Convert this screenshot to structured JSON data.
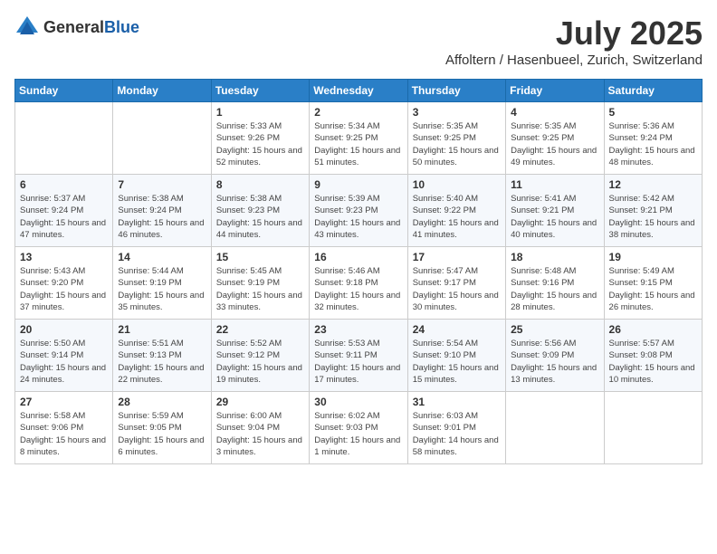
{
  "logo": {
    "general": "General",
    "blue": "Blue"
  },
  "header": {
    "month_title": "July 2025",
    "location": "Affoltern / Hasenbueel, Zurich, Switzerland"
  },
  "weekdays": [
    "Sunday",
    "Monday",
    "Tuesday",
    "Wednesday",
    "Thursday",
    "Friday",
    "Saturday"
  ],
  "weeks": [
    [
      {
        "day": "",
        "sunrise": "",
        "sunset": "",
        "daylight": ""
      },
      {
        "day": "",
        "sunrise": "",
        "sunset": "",
        "daylight": ""
      },
      {
        "day": "1",
        "sunrise": "Sunrise: 5:33 AM",
        "sunset": "Sunset: 9:26 PM",
        "daylight": "Daylight: 15 hours and 52 minutes."
      },
      {
        "day": "2",
        "sunrise": "Sunrise: 5:34 AM",
        "sunset": "Sunset: 9:25 PM",
        "daylight": "Daylight: 15 hours and 51 minutes."
      },
      {
        "day": "3",
        "sunrise": "Sunrise: 5:35 AM",
        "sunset": "Sunset: 9:25 PM",
        "daylight": "Daylight: 15 hours and 50 minutes."
      },
      {
        "day": "4",
        "sunrise": "Sunrise: 5:35 AM",
        "sunset": "Sunset: 9:25 PM",
        "daylight": "Daylight: 15 hours and 49 minutes."
      },
      {
        "day": "5",
        "sunrise": "Sunrise: 5:36 AM",
        "sunset": "Sunset: 9:24 PM",
        "daylight": "Daylight: 15 hours and 48 minutes."
      }
    ],
    [
      {
        "day": "6",
        "sunrise": "Sunrise: 5:37 AM",
        "sunset": "Sunset: 9:24 PM",
        "daylight": "Daylight: 15 hours and 47 minutes."
      },
      {
        "day": "7",
        "sunrise": "Sunrise: 5:38 AM",
        "sunset": "Sunset: 9:24 PM",
        "daylight": "Daylight: 15 hours and 46 minutes."
      },
      {
        "day": "8",
        "sunrise": "Sunrise: 5:38 AM",
        "sunset": "Sunset: 9:23 PM",
        "daylight": "Daylight: 15 hours and 44 minutes."
      },
      {
        "day": "9",
        "sunrise": "Sunrise: 5:39 AM",
        "sunset": "Sunset: 9:23 PM",
        "daylight": "Daylight: 15 hours and 43 minutes."
      },
      {
        "day": "10",
        "sunrise": "Sunrise: 5:40 AM",
        "sunset": "Sunset: 9:22 PM",
        "daylight": "Daylight: 15 hours and 41 minutes."
      },
      {
        "day": "11",
        "sunrise": "Sunrise: 5:41 AM",
        "sunset": "Sunset: 9:21 PM",
        "daylight": "Daylight: 15 hours and 40 minutes."
      },
      {
        "day": "12",
        "sunrise": "Sunrise: 5:42 AM",
        "sunset": "Sunset: 9:21 PM",
        "daylight": "Daylight: 15 hours and 38 minutes."
      }
    ],
    [
      {
        "day": "13",
        "sunrise": "Sunrise: 5:43 AM",
        "sunset": "Sunset: 9:20 PM",
        "daylight": "Daylight: 15 hours and 37 minutes."
      },
      {
        "day": "14",
        "sunrise": "Sunrise: 5:44 AM",
        "sunset": "Sunset: 9:19 PM",
        "daylight": "Daylight: 15 hours and 35 minutes."
      },
      {
        "day": "15",
        "sunrise": "Sunrise: 5:45 AM",
        "sunset": "Sunset: 9:19 PM",
        "daylight": "Daylight: 15 hours and 33 minutes."
      },
      {
        "day": "16",
        "sunrise": "Sunrise: 5:46 AM",
        "sunset": "Sunset: 9:18 PM",
        "daylight": "Daylight: 15 hours and 32 minutes."
      },
      {
        "day": "17",
        "sunrise": "Sunrise: 5:47 AM",
        "sunset": "Sunset: 9:17 PM",
        "daylight": "Daylight: 15 hours and 30 minutes."
      },
      {
        "day": "18",
        "sunrise": "Sunrise: 5:48 AM",
        "sunset": "Sunset: 9:16 PM",
        "daylight": "Daylight: 15 hours and 28 minutes."
      },
      {
        "day": "19",
        "sunrise": "Sunrise: 5:49 AM",
        "sunset": "Sunset: 9:15 PM",
        "daylight": "Daylight: 15 hours and 26 minutes."
      }
    ],
    [
      {
        "day": "20",
        "sunrise": "Sunrise: 5:50 AM",
        "sunset": "Sunset: 9:14 PM",
        "daylight": "Daylight: 15 hours and 24 minutes."
      },
      {
        "day": "21",
        "sunrise": "Sunrise: 5:51 AM",
        "sunset": "Sunset: 9:13 PM",
        "daylight": "Daylight: 15 hours and 22 minutes."
      },
      {
        "day": "22",
        "sunrise": "Sunrise: 5:52 AM",
        "sunset": "Sunset: 9:12 PM",
        "daylight": "Daylight: 15 hours and 19 minutes."
      },
      {
        "day": "23",
        "sunrise": "Sunrise: 5:53 AM",
        "sunset": "Sunset: 9:11 PM",
        "daylight": "Daylight: 15 hours and 17 minutes."
      },
      {
        "day": "24",
        "sunrise": "Sunrise: 5:54 AM",
        "sunset": "Sunset: 9:10 PM",
        "daylight": "Daylight: 15 hours and 15 minutes."
      },
      {
        "day": "25",
        "sunrise": "Sunrise: 5:56 AM",
        "sunset": "Sunset: 9:09 PM",
        "daylight": "Daylight: 15 hours and 13 minutes."
      },
      {
        "day": "26",
        "sunrise": "Sunrise: 5:57 AM",
        "sunset": "Sunset: 9:08 PM",
        "daylight": "Daylight: 15 hours and 10 minutes."
      }
    ],
    [
      {
        "day": "27",
        "sunrise": "Sunrise: 5:58 AM",
        "sunset": "Sunset: 9:06 PM",
        "daylight": "Daylight: 15 hours and 8 minutes."
      },
      {
        "day": "28",
        "sunrise": "Sunrise: 5:59 AM",
        "sunset": "Sunset: 9:05 PM",
        "daylight": "Daylight: 15 hours and 6 minutes."
      },
      {
        "day": "29",
        "sunrise": "Sunrise: 6:00 AM",
        "sunset": "Sunset: 9:04 PM",
        "daylight": "Daylight: 15 hours and 3 minutes."
      },
      {
        "day": "30",
        "sunrise": "Sunrise: 6:02 AM",
        "sunset": "Sunset: 9:03 PM",
        "daylight": "Daylight: 15 hours and 1 minute."
      },
      {
        "day": "31",
        "sunrise": "Sunrise: 6:03 AM",
        "sunset": "Sunset: 9:01 PM",
        "daylight": "Daylight: 14 hours and 58 minutes."
      },
      {
        "day": "",
        "sunrise": "",
        "sunset": "",
        "daylight": ""
      },
      {
        "day": "",
        "sunrise": "",
        "sunset": "",
        "daylight": ""
      }
    ]
  ]
}
